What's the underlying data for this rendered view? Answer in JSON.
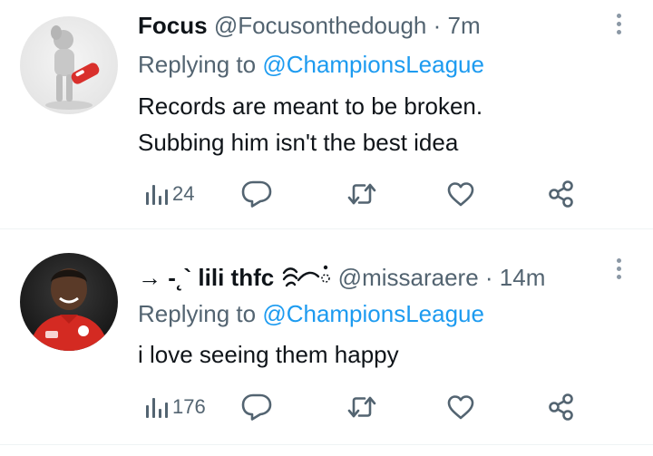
{
  "tweets": [
    {
      "name": "Focus",
      "handle": "@Focusonthedough",
      "separator": "·",
      "time": "7m",
      "replying_prefix": "Replying to ",
      "replying_to": "@ChampionsLeague",
      "text_lines": [
        "Records are meant to be broken.",
        "Subbing him isn't the best idea"
      ],
      "views": "24",
      "avatar_icon": "toy-figure-avatar"
    },
    {
      "name_prefix": "→ -˛` lili thfc",
      "name_emoji": "wave-icon",
      "handle": "@missaraere",
      "separator": "·",
      "time": "14m",
      "replying_prefix": "Replying to ",
      "replying_to": "@ChampionsLeague",
      "text_lines": [
        "i love seeing them happy"
      ],
      "views": "176",
      "avatar_icon": "player-photo-avatar"
    }
  ],
  "colors": {
    "accent": "#1d9bf0",
    "secondary_text": "#536471",
    "primary_text": "#0f1419",
    "icon": "#536471",
    "divider": "#eff3f4"
  }
}
